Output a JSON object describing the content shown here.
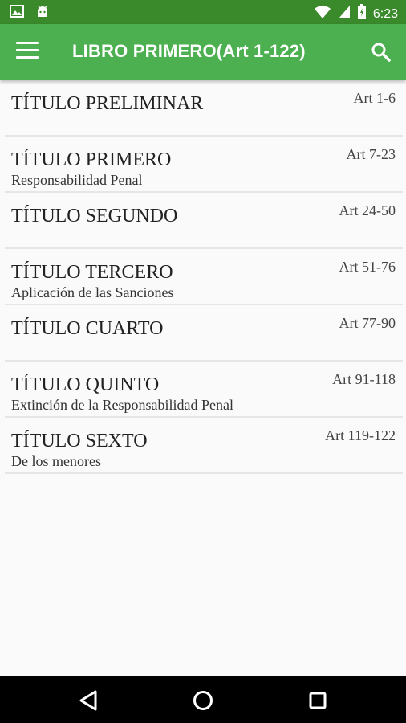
{
  "status_bar": {
    "time": "6:23",
    "icons": [
      "image-icon",
      "android-icon",
      "wifi-icon",
      "signal-icon",
      "battery-icon"
    ]
  },
  "app_bar": {
    "title": "LIBRO PRIMERO(Art 1-122)",
    "menu_icon": "menu-icon",
    "search_icon": "search-icon",
    "color": "#4caf50",
    "status_color": "#3a8a2c"
  },
  "titles": [
    {
      "title": "TÍTULO PRELIMINAR",
      "subtitle": "",
      "articles": "Art 1-6"
    },
    {
      "title": "TÍTULO PRIMERO",
      "subtitle": "Responsabilidad Penal",
      "articles": "Art 7-23"
    },
    {
      "title": "TÍTULO SEGUNDO",
      "subtitle": "",
      "articles": "Art 24-50"
    },
    {
      "title": "TÍTULO TERCERO",
      "subtitle": "Aplicación de las Sanciones",
      "articles": "Art 51-76"
    },
    {
      "title": "TÍTULO CUARTO",
      "subtitle": "",
      "articles": "Art 77-90"
    },
    {
      "title": "TÍTULO QUINTO",
      "subtitle": "Extinción de la Responsabilidad Penal",
      "articles": "Art 91-118"
    },
    {
      "title": "TÍTULO SEXTO",
      "subtitle": "De los menores",
      "articles": "Art 119-122"
    }
  ],
  "nav_bar": {
    "icons": [
      "back-icon",
      "home-icon",
      "recents-icon"
    ]
  }
}
